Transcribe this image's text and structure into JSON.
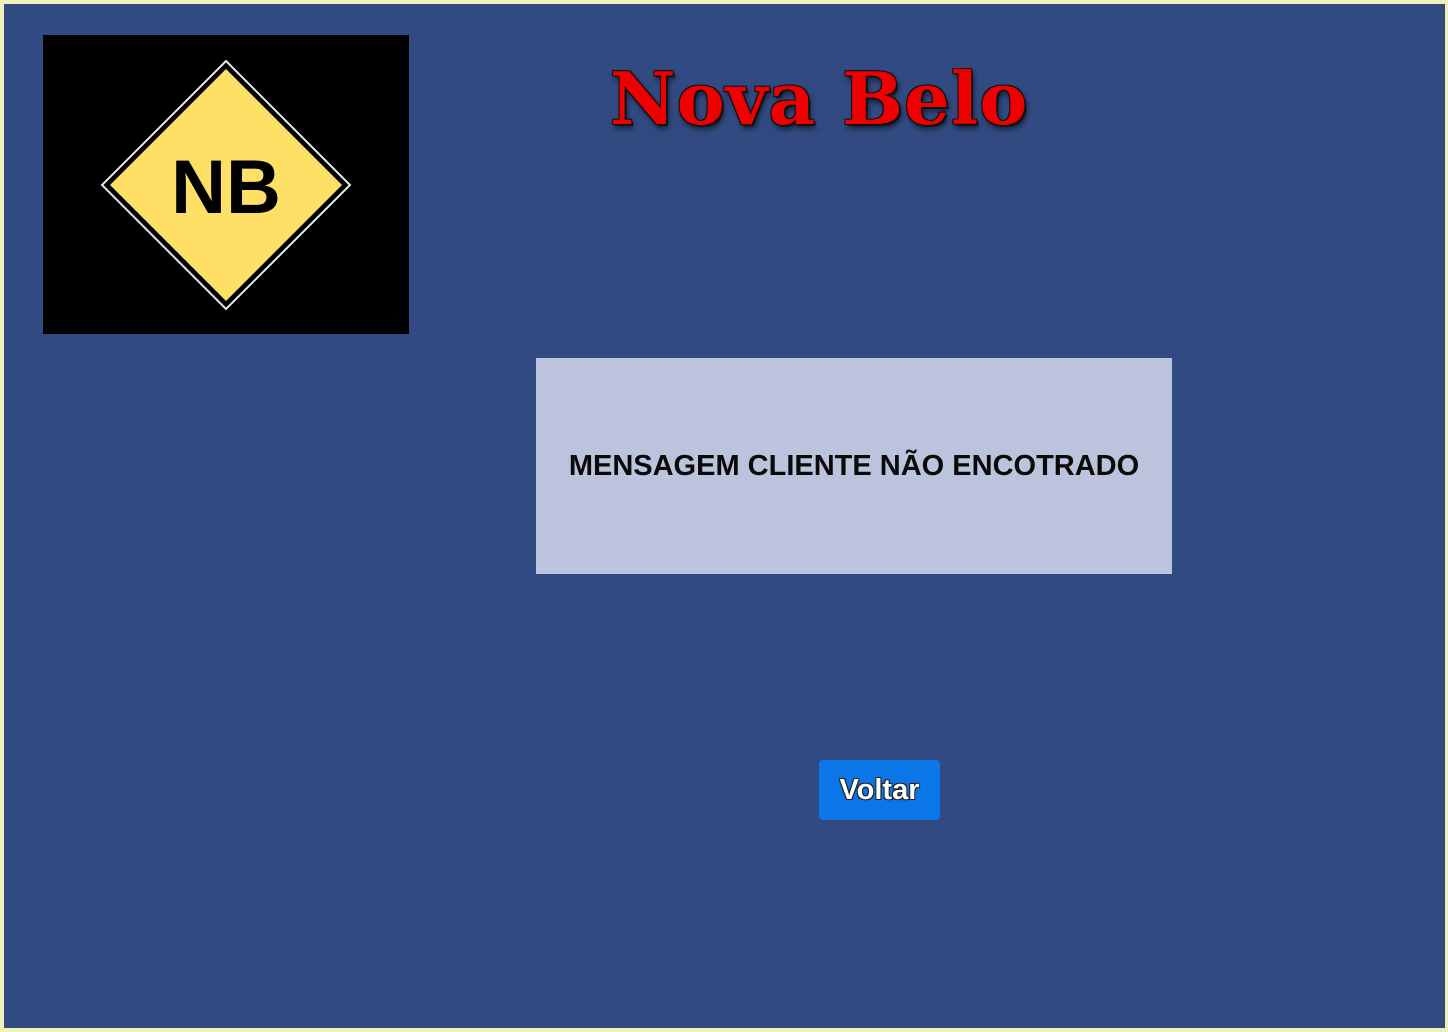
{
  "header": {
    "title": "Nova Belo",
    "logo": {
      "text": "NB",
      "background_color": "#000000",
      "diamond_color": "#ffe066",
      "text_color": "#000000"
    }
  },
  "main": {
    "message": "MENSAGEM CLIENTE NÃO ENCOTRADO",
    "back_button_label": "Voltar"
  },
  "colors": {
    "page_background": "#324a82",
    "title": "#ee0000",
    "message_box": "#bcc3dc",
    "button": "#0a76e8"
  }
}
